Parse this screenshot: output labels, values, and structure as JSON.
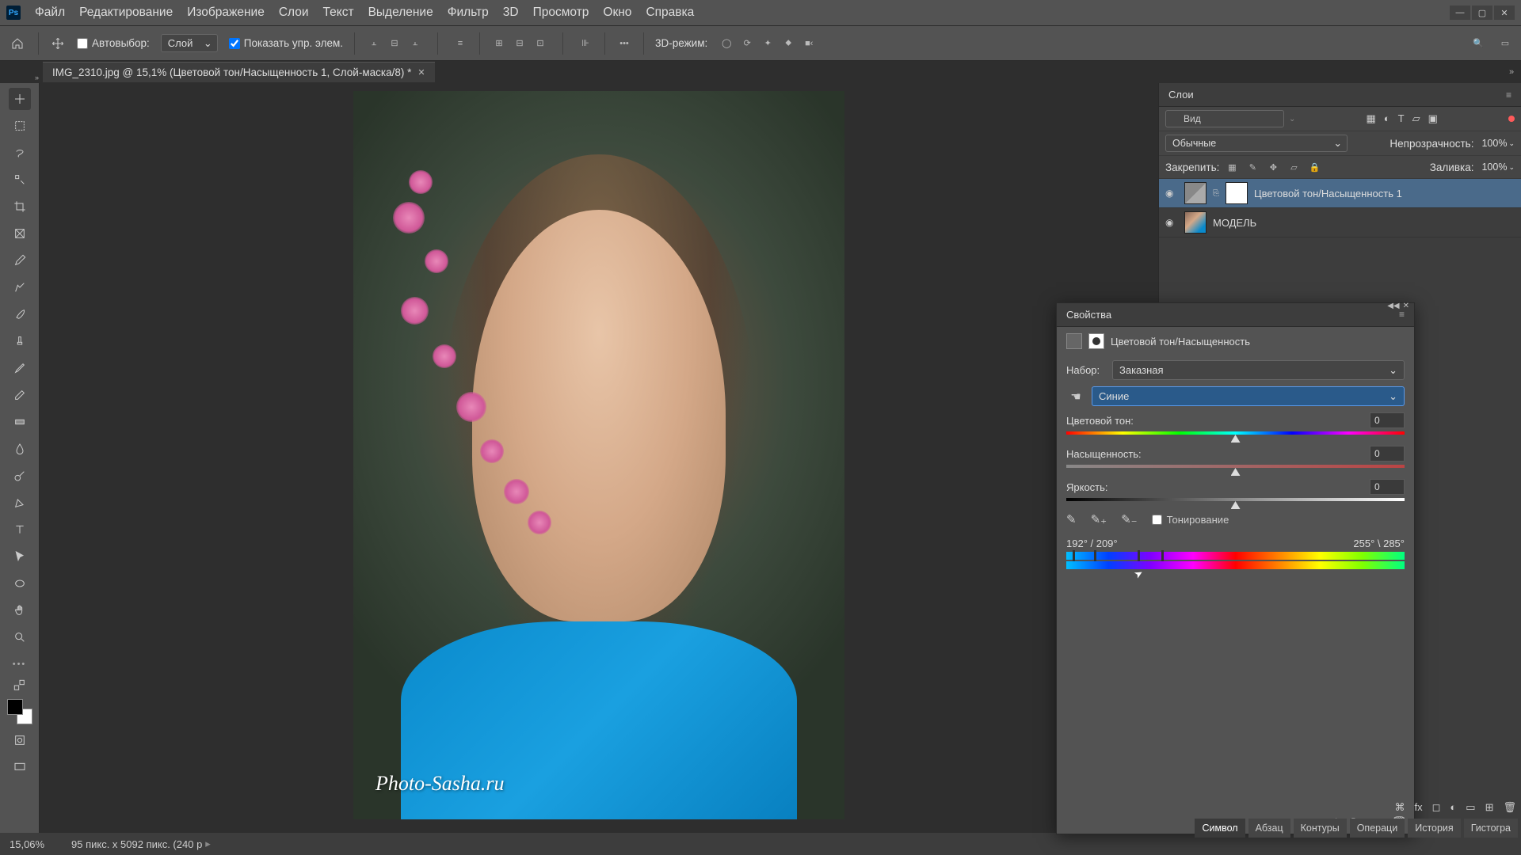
{
  "menu": {
    "items": [
      "Файл",
      "Редактирование",
      "Изображение",
      "Слои",
      "Текст",
      "Выделение",
      "Фильтр",
      "3D",
      "Просмотр",
      "Окно",
      "Справка"
    ]
  },
  "options": {
    "autoselect": "Автовыбор:",
    "layer_select": "Слой",
    "show_controls": "Показать упр. элем.",
    "mode3d": "3D-режим:"
  },
  "tab": {
    "title": "IMG_2310.jpg @ 15,1% (Цветовой тон/Насыщенность 1, Слой-маска/8) *"
  },
  "watermark": "Photo-Sasha.ru",
  "layers": {
    "panel_title": "Слои",
    "kind": "Вид",
    "blend": "Обычные",
    "opacity_label": "Непрозрачность:",
    "opacity": "100%",
    "lock_label": "Закрепить:",
    "fill_label": "Заливка:",
    "fill": "100%",
    "items": [
      {
        "name": "Цветовой тон/Насыщенность 1"
      },
      {
        "name": "МОДЕЛЬ"
      }
    ]
  },
  "props": {
    "title": "Свойства",
    "adj_name": "Цветовой тон/Насыщенность",
    "preset_label": "Набор:",
    "preset": "Заказная",
    "channel": "Синие",
    "hue_label": "Цветовой тон:",
    "hue_val": "0",
    "sat_label": "Насыщенность:",
    "sat_val": "0",
    "lit_label": "Яркость:",
    "lit_val": "0",
    "tint": "Тонирование",
    "range_left": "192° / 209°",
    "range_right": "255° \\ 285°"
  },
  "bottom_tabs": [
    "Символ",
    "Абзац",
    "Контуры",
    "Операци",
    "История",
    "Гистогра"
  ],
  "status": {
    "zoom": "15,06%",
    "info": "95 пикс. x 5092 пикс. (240 p"
  }
}
